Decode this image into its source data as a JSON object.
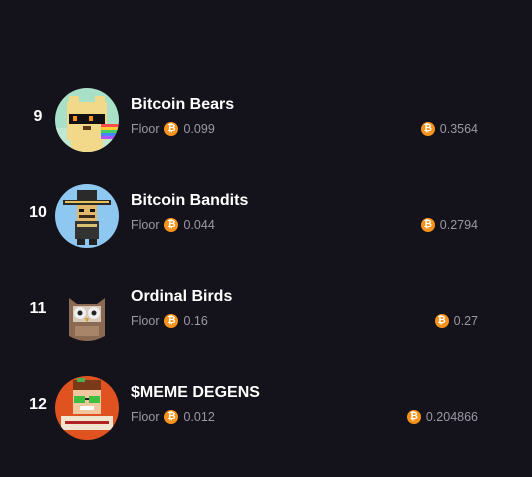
{
  "floor_label": "Floor",
  "currency_icon": "bitcoin-icon",
  "currency_glyph": "₿",
  "accent_color": "#f7931a",
  "collections": [
    {
      "rank": "9",
      "name": "Bitcoin Bears",
      "floor": "0.099",
      "volume": "0.3564",
      "avatar": "bear-avatar-icon"
    },
    {
      "rank": "10",
      "name": "Bitcoin Bandits",
      "floor": "0.044",
      "volume": "0.2794",
      "avatar": "bandit-avatar-icon"
    },
    {
      "rank": "11",
      "name": "Ordinal Birds",
      "floor": "0.16",
      "volume": "0.27",
      "avatar": "owl-avatar-icon"
    },
    {
      "rank": "12",
      "name": "$MEME DEGENS",
      "floor": "0.012",
      "volume": "0.204866",
      "avatar": "degen-avatar-icon"
    }
  ]
}
